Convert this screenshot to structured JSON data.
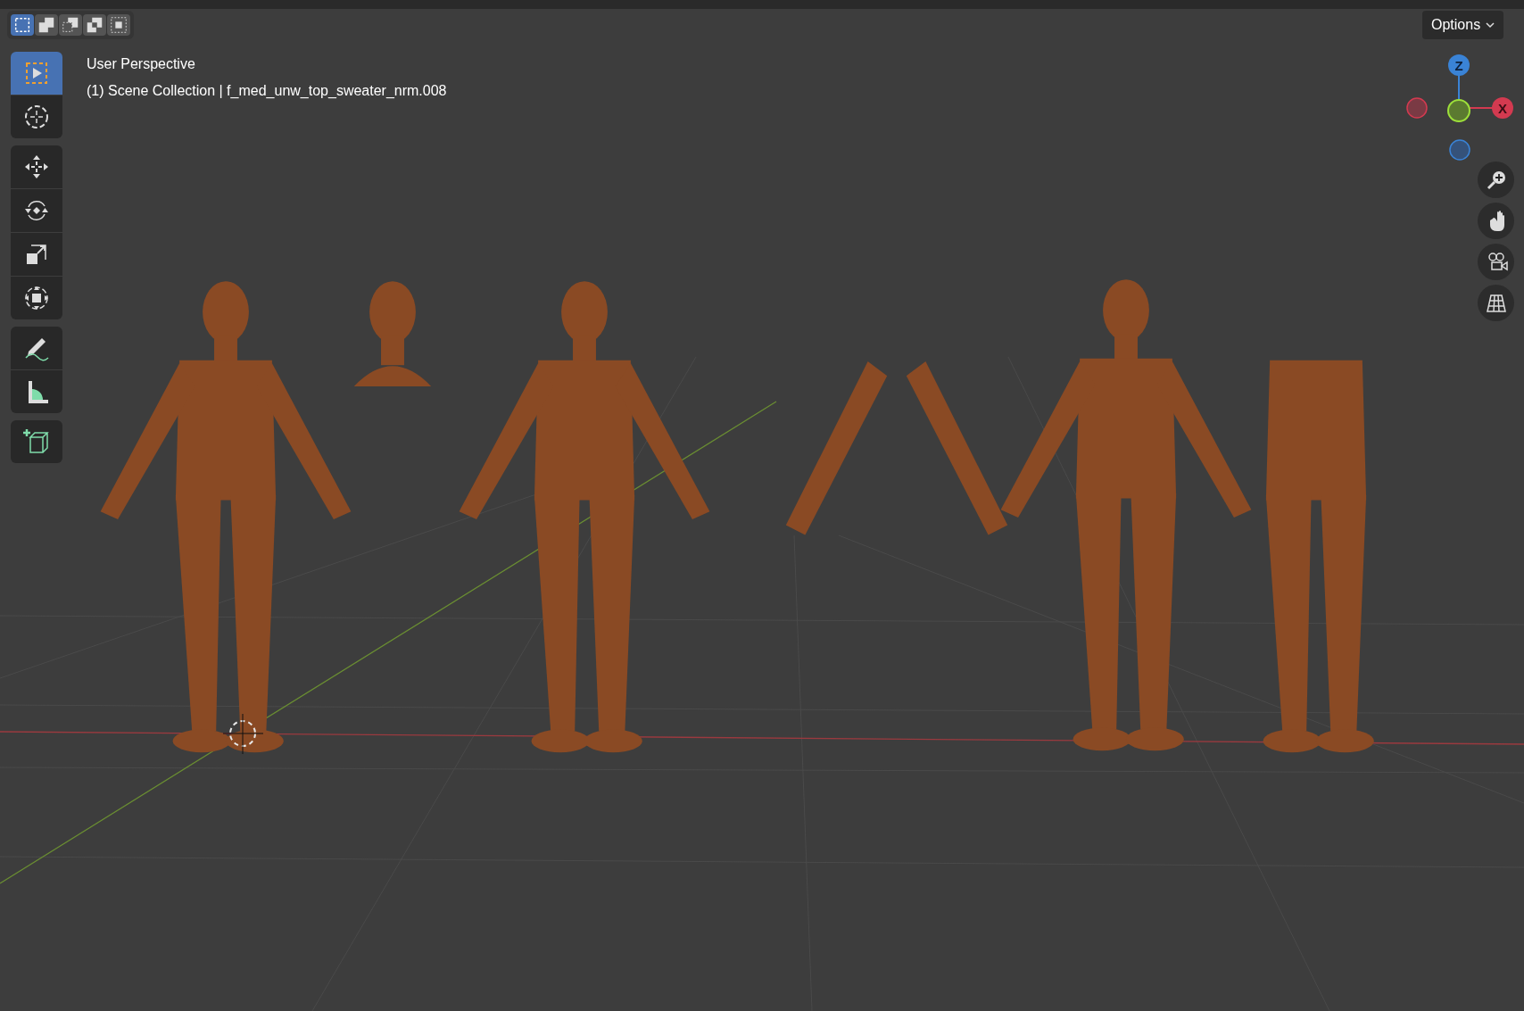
{
  "select_modes": [
    {
      "kind": "new",
      "selected": true
    },
    {
      "kind": "extend",
      "selected": false
    },
    {
      "kind": "subtract",
      "selected": false
    },
    {
      "kind": "invert",
      "selected": false
    },
    {
      "kind": "intersect",
      "selected": false
    }
  ],
  "options_button": {
    "label": "Options"
  },
  "viewport": {
    "title": "User Perspective",
    "context": "(1) Scene Collection | f_med_unw_top_sweater_nrm.008"
  },
  "tool_groups": [
    [
      {
        "kind": "select",
        "selected": true
      },
      {
        "kind": "cursor",
        "selected": false
      }
    ],
    [
      {
        "kind": "move",
        "selected": false
      },
      {
        "kind": "rotate",
        "selected": false
      },
      {
        "kind": "scale",
        "selected": false
      },
      {
        "kind": "transform",
        "selected": false
      }
    ],
    [
      {
        "kind": "annotate",
        "selected": false
      },
      {
        "kind": "measure",
        "selected": false
      }
    ],
    [
      {
        "kind": "add-cube",
        "selected": false
      }
    ]
  ],
  "gizmo": {
    "z_label": "Z",
    "x_label": "X"
  },
  "nav_buttons": [
    {
      "kind": "zoom"
    },
    {
      "kind": "pan"
    },
    {
      "kind": "camera"
    },
    {
      "kind": "ortho"
    }
  ],
  "scene_objects": [
    {
      "kind": "full"
    },
    {
      "kind": "head"
    },
    {
      "kind": "full"
    },
    {
      "kind": "arms"
    },
    {
      "kind": "full"
    },
    {
      "kind": "body"
    }
  ]
}
